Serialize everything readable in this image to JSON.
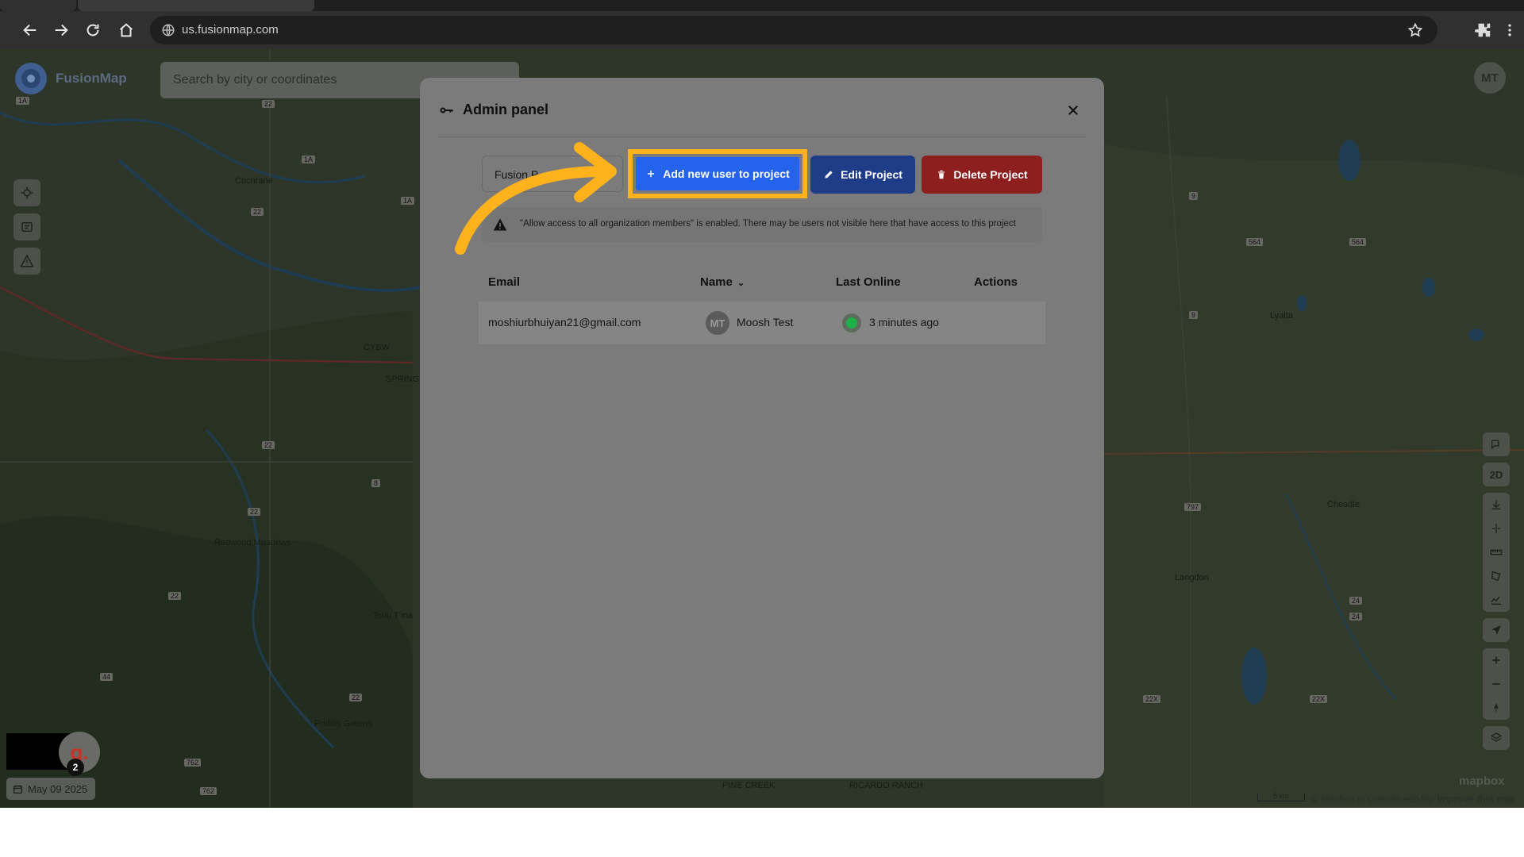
{
  "browser": {
    "url": "us.fusionmap.com"
  },
  "app": {
    "name": "FusionMap",
    "search_placeholder": "Search by city or coordinates",
    "user_initials": "MT",
    "notification_count": "2",
    "badge_letter": "g.",
    "date": "May 09 2025",
    "map_labels": [
      "Cochrane",
      "Redwood Meadows",
      "Tsuu T'ina",
      "Priddis Greens",
      "CYBW",
      "SPRING",
      "Lyalta",
      "Cheadle",
      "Langdon",
      "PINE CREEK",
      "RICARDO RANCH"
    ],
    "road_labels": [
      "22",
      "1A",
      "1A",
      "1A",
      "22",
      "22",
      "8",
      "22",
      "22",
      "44",
      "762",
      "762",
      "22",
      "9",
      "9",
      "564",
      "564",
      "797",
      "24",
      "24",
      "22X",
      "22X"
    ],
    "view_mode": "2D",
    "attribution": "© Mapbox © OpenStreetMap",
    "improve_link": "Improve this map",
    "scale_label": "5 km",
    "mapbox_logo": "mapbox"
  },
  "modal": {
    "title": "Admin panel",
    "project_select_value": "Fusion P",
    "buttons": {
      "add_user": "Add new user to project",
      "edit": "Edit Project",
      "delete": "Delete Project"
    },
    "warning": "\"Allow access to all organization members\" is enabled. There may be users not visible here that have access to this project",
    "columns": [
      "Email",
      "Name",
      "Last Online",
      "Actions"
    ],
    "rows": [
      {
        "email": "moshiurbhuiyan21@gmail.com",
        "initials": "MT",
        "name": "Moosh Test",
        "last_online": "3 minutes ago"
      }
    ]
  },
  "colors": {
    "highlight": "#ffb21c",
    "add_button": "#2463eb",
    "edit_button": "#1f3c88",
    "delete_button": "#8e1f1f",
    "online_status": "#1eb148"
  }
}
